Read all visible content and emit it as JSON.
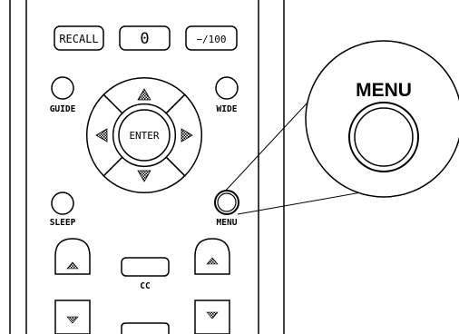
{
  "remote": {
    "top_row": {
      "recall_label": "RECALL",
      "zero_label": "0",
      "dash100_label": "−/100"
    },
    "side_buttons": {
      "guide_label": "GUIDE",
      "wide_label": "WIDE",
      "sleep_label": "SLEEP",
      "menu_label": "MENU"
    },
    "dpad": {
      "enter_label": "ENTER"
    },
    "bottom": {
      "cc_label": "CC"
    }
  },
  "callout": {
    "label": "MENU"
  },
  "colors": {
    "stroke": "#000000",
    "background": "#ffffff"
  }
}
